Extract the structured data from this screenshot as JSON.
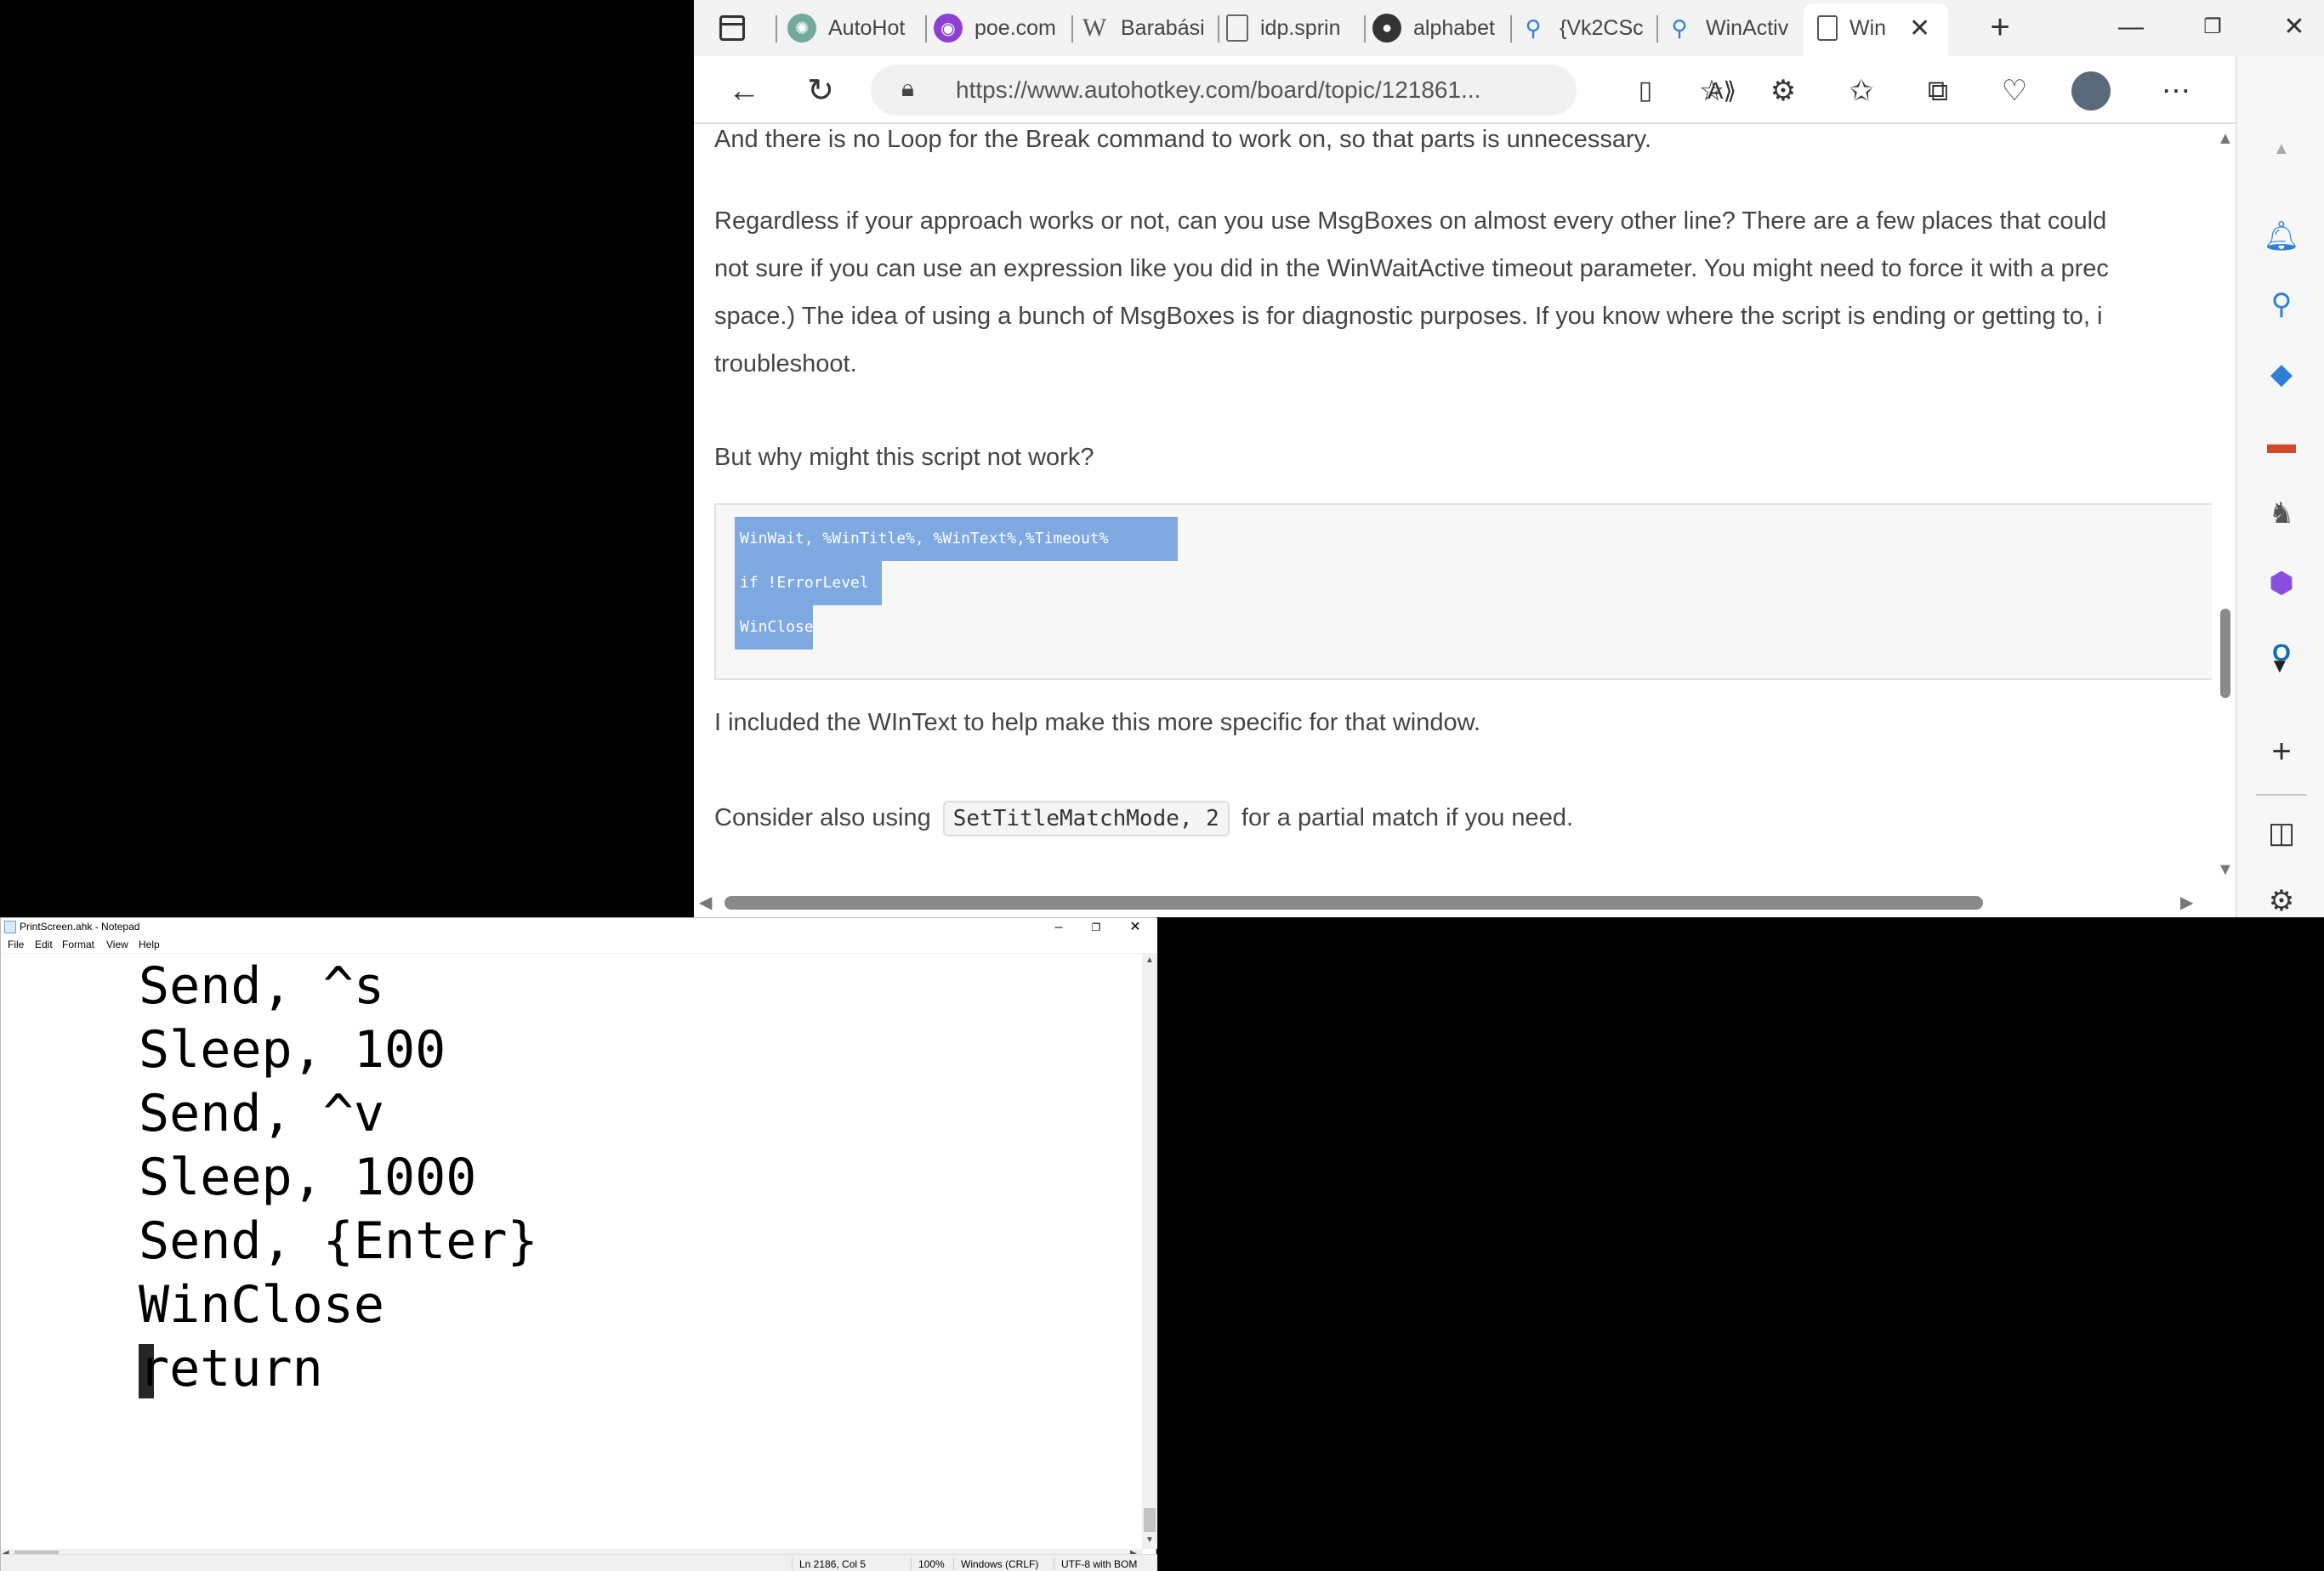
{
  "browser": {
    "tabs": [
      {
        "label": "",
        "icon": "tab-actions-icon"
      },
      {
        "label": "AutoHot",
        "icon": "chatgpt-icon"
      },
      {
        "label": "poe.com",
        "icon": "poe-icon"
      },
      {
        "label": "Barabási",
        "icon": "wikipedia-icon"
      },
      {
        "label": "idp.sprin",
        "icon": "page-icon"
      },
      {
        "label": "alphabet",
        "icon": "github-icon"
      },
      {
        "label": "{Vk2CSc",
        "icon": "search-icon"
      },
      {
        "label": "WinActiv",
        "icon": "search-icon"
      },
      {
        "label": "Win",
        "icon": "page-icon"
      }
    ],
    "url": "https://www.autohotkey.com/board/topic/121861...",
    "content": {
      "line_top": "And there is no Loop for the Break command to work on, so that parts is unnecessary.",
      "para2_line1": "Regardless if your approach works or not, can you use MsgBoxes on almost every other line? There are a few places that could",
      "para2_line2": "not sure if you can use an expression like you did in the WinWaitActive timeout parameter. You might need to force it with a prec",
      "para2_line3": "space.) The idea of using a bunch of MsgBoxes is for diagnostic purposes. If you know where the script is ending or getting to, i",
      "para2_line4": "troubleshoot.",
      "para3": "But why might this script not work?",
      "code_lines": [
        "WinWait, %WinTitle%, %WinText%,%Timeout%",
        "if !ErrorLevel",
        "WinClose"
      ],
      "para4": "I included the WInText to help make this more specific for that window.",
      "para5_before": "Consider also using",
      "para5_code": "SetTitleMatchMode, 2",
      "para5_after": "for a partial match if you need."
    }
  },
  "notepad": {
    "title": "PrintScreen.ahk - Notepad",
    "menu": [
      "File",
      "Edit",
      "Format",
      "View",
      "Help"
    ],
    "lines": [
      "Send, ^s",
      "Sleep, 100",
      "Send, ^v",
      "Sleep, 1000",
      "Send, {Enter}",
      "WinClose",
      "return"
    ],
    "status": {
      "position": "Ln 2186, Col 5",
      "zoom": "100%",
      "line_ending": "Windows (CRLF)",
      "encoding": "UTF-8 with BOM"
    }
  }
}
